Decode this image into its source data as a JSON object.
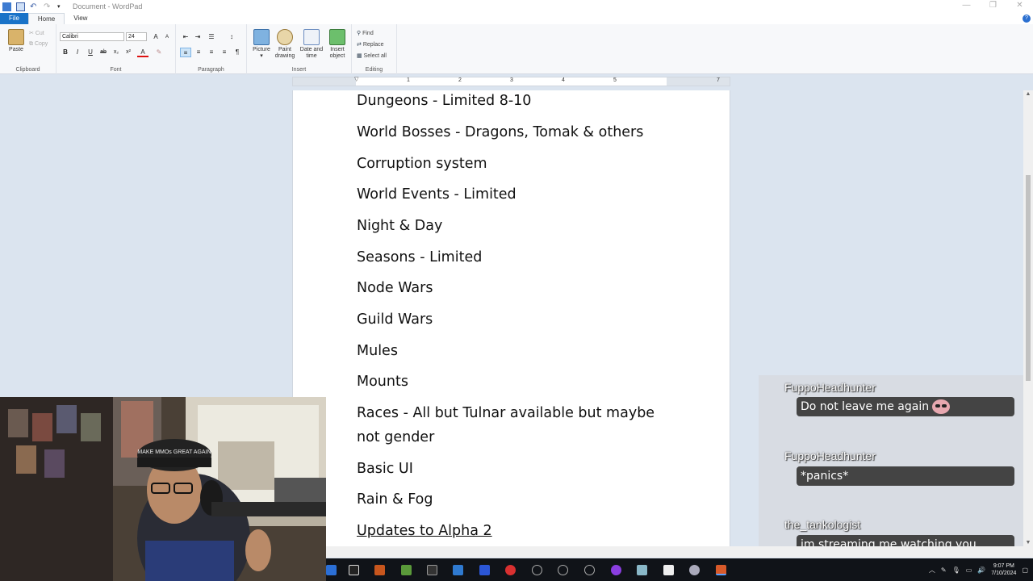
{
  "window": {
    "title": "Document - WordPad"
  },
  "ribbon": {
    "tabs": [
      "File",
      "Home",
      "View"
    ],
    "clipboard": {
      "label": "Clipboard",
      "paste": "Paste",
      "cut": "Cut",
      "copy": "Copy"
    },
    "font": {
      "label": "Font",
      "family": "Calibri",
      "size": "24"
    },
    "paragraph": {
      "label": "Paragraph"
    },
    "insert": {
      "label": "Insert",
      "picture": "Picture",
      "paint_drawing": "Paint drawing",
      "date_time": "Date and time",
      "insert_object": "Insert object"
    },
    "editing": {
      "label": "Editing",
      "find": "Find",
      "replace": "Replace",
      "select_all": "Select all"
    }
  },
  "ruler": {
    "numbers": [
      "1",
      "2",
      "3",
      "4",
      "5",
      "7"
    ]
  },
  "document": {
    "lines": [
      "Dungeons - Limited 8-10",
      "World Bosses - Dragons, Tomak & others",
      "Corruption system",
      "World Events - Limited",
      "Night & Day",
      "Seasons - Limited",
      "Node Wars",
      "Guild Wars",
      "Mules",
      "Mounts",
      "Races - All but Tulnar available but maybe",
      "not gender",
      "Basic UI",
      "Rain & Fog",
      "Updates to Alpha 2"
    ]
  },
  "webcam": {
    "hat_text": "MAKE MMOs GREAT AGAIN"
  },
  "chat": {
    "messages": [
      {
        "user": "FuppoHeadhunter",
        "text": "Do not leave me again",
        "emote": "blush-emote"
      },
      {
        "user": "FuppoHeadhunter",
        "text": "*panics*"
      },
      {
        "user": "the_tankologist",
        "text": "im streaming me watching you"
      }
    ]
  },
  "taskbar": {
    "time": "9:07 PM",
    "date": "7/10/2024"
  }
}
